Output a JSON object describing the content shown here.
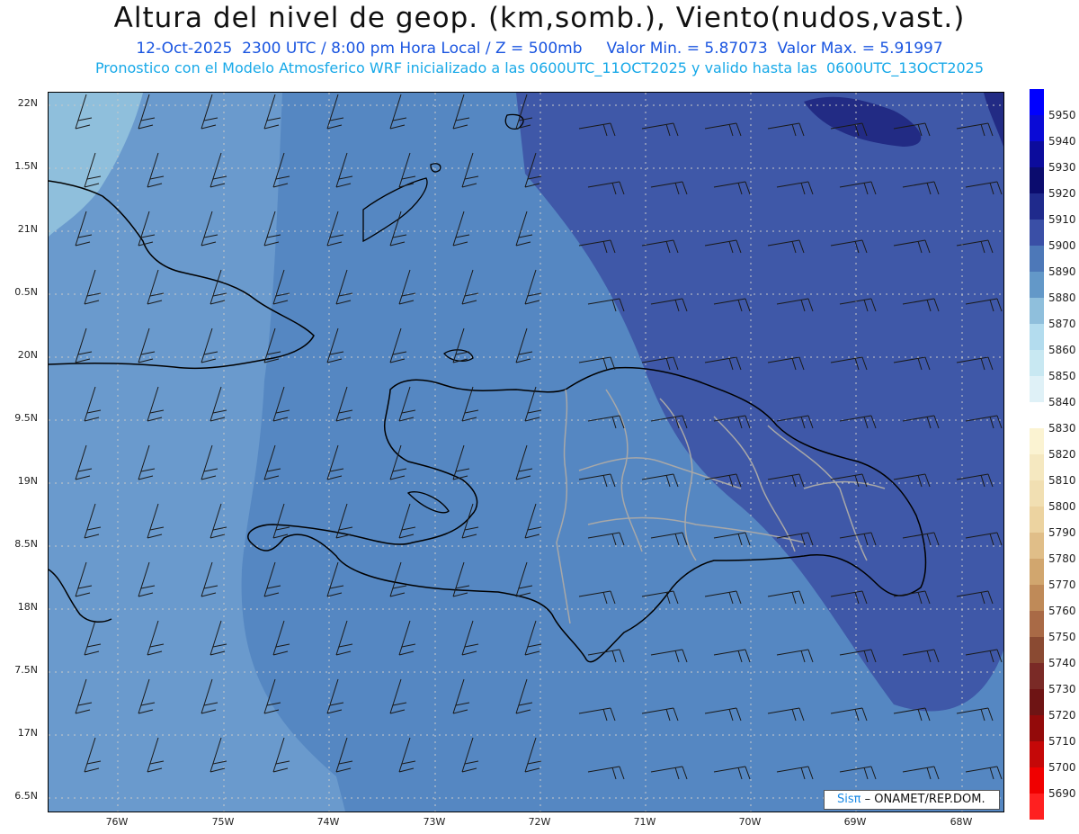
{
  "title": "Altura del nivel de geop. (km,somb.), Viento(nudos,vast.)",
  "subtitle": "12-Oct-2025  2300 UTC / 8:00 pm Hora Local / Z = 500mb     Valor Min. = 5.87073  Valor Max. = 5.91997",
  "subtitle2": "Pronostico con el Modelo Atmosferico WRF inicializado a las 0600UTC_11OCT2025 y valido hasta las  0600UTC_13OCT2025",
  "lat_labels": [
    "22N",
    "1.5N",
    "21N",
    "0.5N",
    "20N",
    "9.5N",
    "19N",
    "8.5N",
    "18N",
    "7.5N",
    "17N",
    "6.5N"
  ],
  "lon_labels": [
    "76W",
    "75W",
    "74W",
    "73W",
    "72W",
    "71W",
    "70W",
    "69W",
    "68W"
  ],
  "legend": {
    "values": [
      "5950",
      "5940",
      "5930",
      "5920",
      "5910",
      "5900",
      "5890",
      "5880",
      "5870",
      "5860",
      "5850",
      "5840",
      "5830",
      "5820",
      "5810",
      "5800",
      "5790",
      "5780",
      "5770",
      "5760",
      "5750",
      "5740",
      "5730",
      "5720",
      "5710",
      "5700",
      "5690"
    ],
    "colors": [
      "#0000ff",
      "#0a0ad6",
      "#0c0c9c",
      "#0b0c6e",
      "#1f2a8c",
      "#3a4fa6",
      "#4d78b8",
      "#6398c8",
      "#8fbfdc",
      "#b3dcee",
      "#c8e8f2",
      "#dff1f7",
      "#ffffff",
      "#fbf3d2",
      "#f5e8c0",
      "#f1dfb2",
      "#ecd3a0",
      "#e0be88",
      "#d1a66e",
      "#bf8a58",
      "#a96a46",
      "#8a4a32",
      "#7a2a26",
      "#6e1414",
      "#930a0a",
      "#c50808",
      "#f00000",
      "#ff2020"
    ]
  },
  "credit_sis": "Sisπ",
  "credit_rest": " – ONAMET/REP.DOM."
}
